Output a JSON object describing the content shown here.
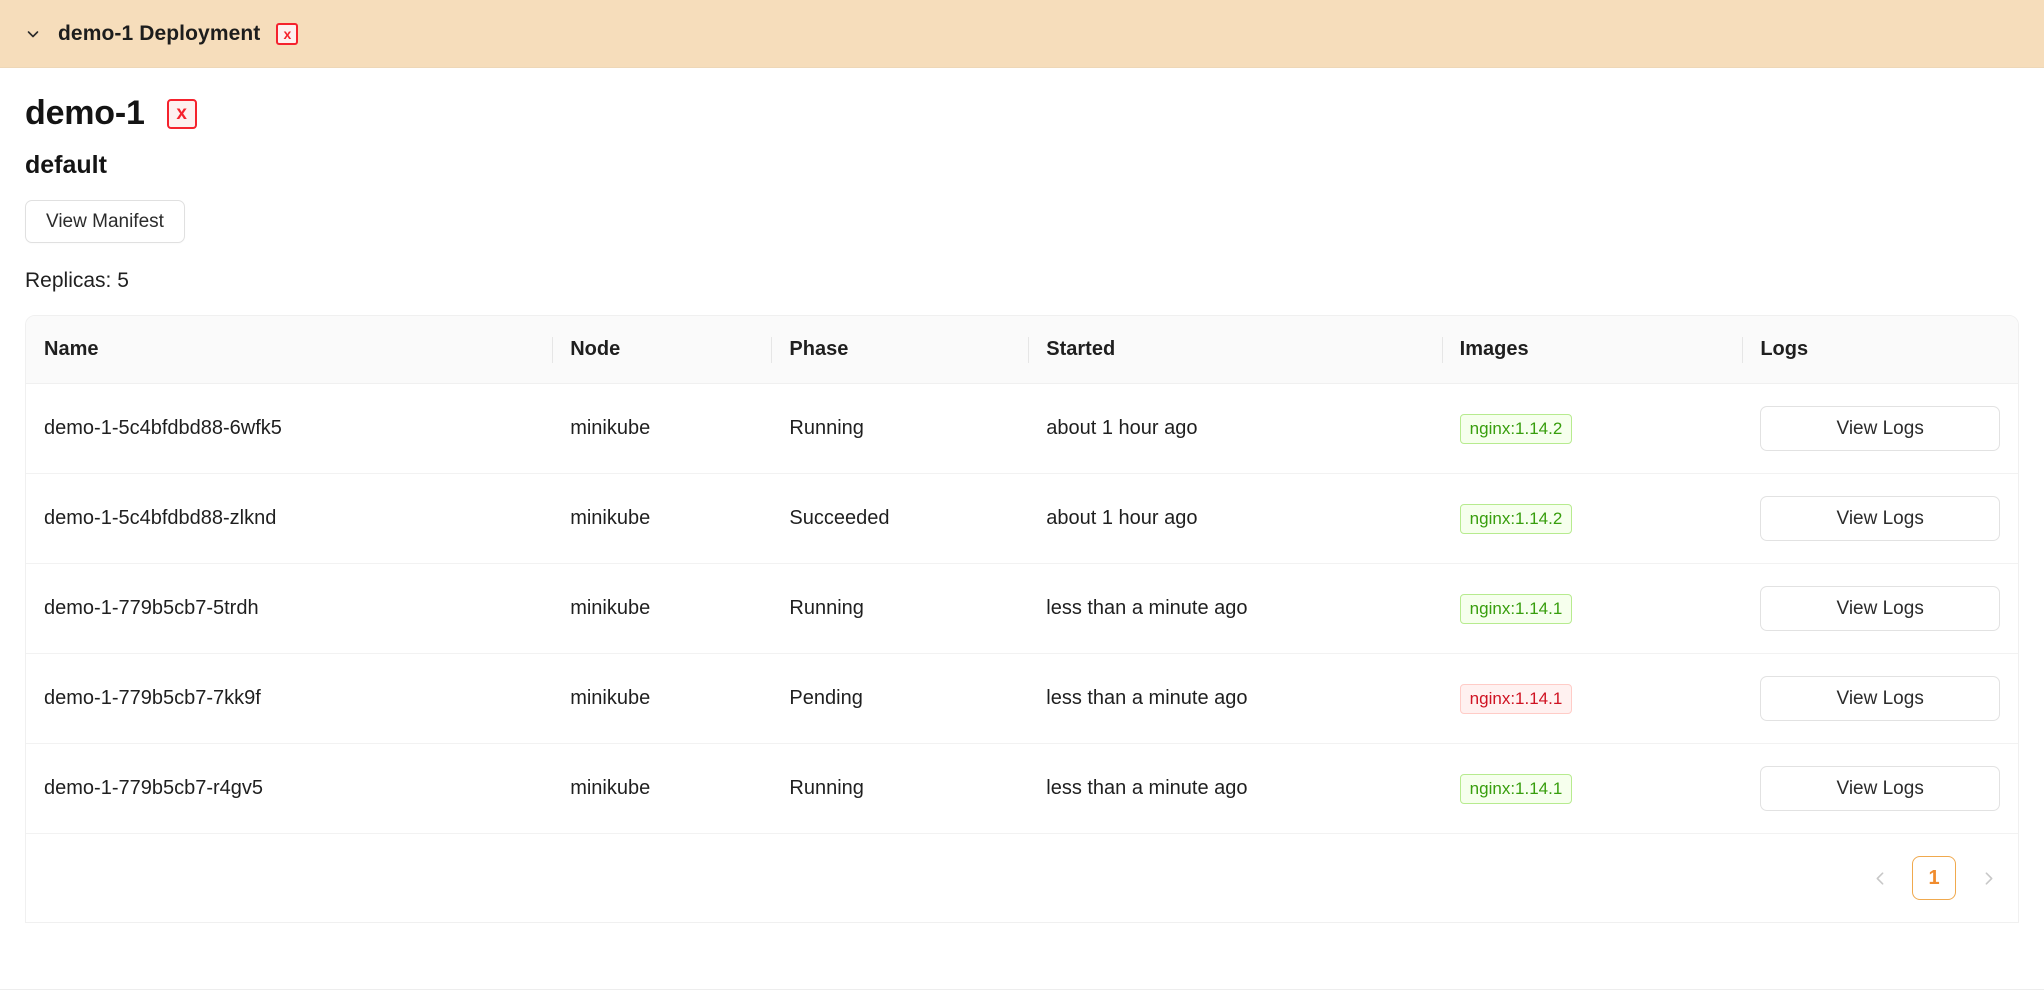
{
  "accordion": {
    "chevron_icon": "chevron-down-icon",
    "title": "demo-1 Deployment",
    "delete_label": "x",
    "background_color": "#f6ddbb"
  },
  "detail": {
    "name": "demo-1",
    "delete_label": "x",
    "namespace": "default",
    "view_manifest_label": "View Manifest",
    "replicas_label": "Replicas: 5"
  },
  "table": {
    "columns": [
      {
        "key": "name",
        "label": "Name"
      },
      {
        "key": "node",
        "label": "Node"
      },
      {
        "key": "phase",
        "label": "Phase"
      },
      {
        "key": "started",
        "label": "Started"
      },
      {
        "key": "images",
        "label": "Images"
      },
      {
        "key": "logs",
        "label": "Logs"
      }
    ],
    "rows": [
      {
        "name": "demo-1-5c4bfdbd88-6wfk5",
        "node": "minikube",
        "phase": "Running",
        "started": "about 1 hour ago",
        "image": "nginx:1.14.2",
        "image_status": "green",
        "logs_label": "View Logs"
      },
      {
        "name": "demo-1-5c4bfdbd88-zlknd",
        "node": "minikube",
        "phase": "Succeeded",
        "started": "about 1 hour ago",
        "image": "nginx:1.14.2",
        "image_status": "green",
        "logs_label": "View Logs"
      },
      {
        "name": "demo-1-779b5cb7-5trdh",
        "node": "minikube",
        "phase": "Running",
        "started": "less than a minute ago",
        "image": "nginx:1.14.1",
        "image_status": "green",
        "logs_label": "View Logs"
      },
      {
        "name": "demo-1-779b5cb7-7kk9f",
        "node": "minikube",
        "phase": "Pending",
        "started": "less than a minute ago",
        "image": "nginx:1.14.1",
        "image_status": "red",
        "logs_label": "View Logs"
      },
      {
        "name": "demo-1-779b5cb7-r4gv5",
        "node": "minikube",
        "phase": "Running",
        "started": "less than a minute ago",
        "image": "nginx:1.14.1",
        "image_status": "green",
        "logs_label": "View Logs"
      }
    ]
  },
  "pagination": {
    "prev_icon": "chevron-left-icon",
    "next_icon": "chevron-right-icon",
    "current_page": "1",
    "accent_color": "#f08c2e"
  },
  "colors": {
    "header_bg": "#f6ddbb",
    "danger": "#f5222d",
    "tag_green_text": "#389e0d",
    "tag_green_bg": "#f6ffed",
    "tag_red_text": "#cf1322",
    "tag_red_bg": "#fff1f0"
  }
}
